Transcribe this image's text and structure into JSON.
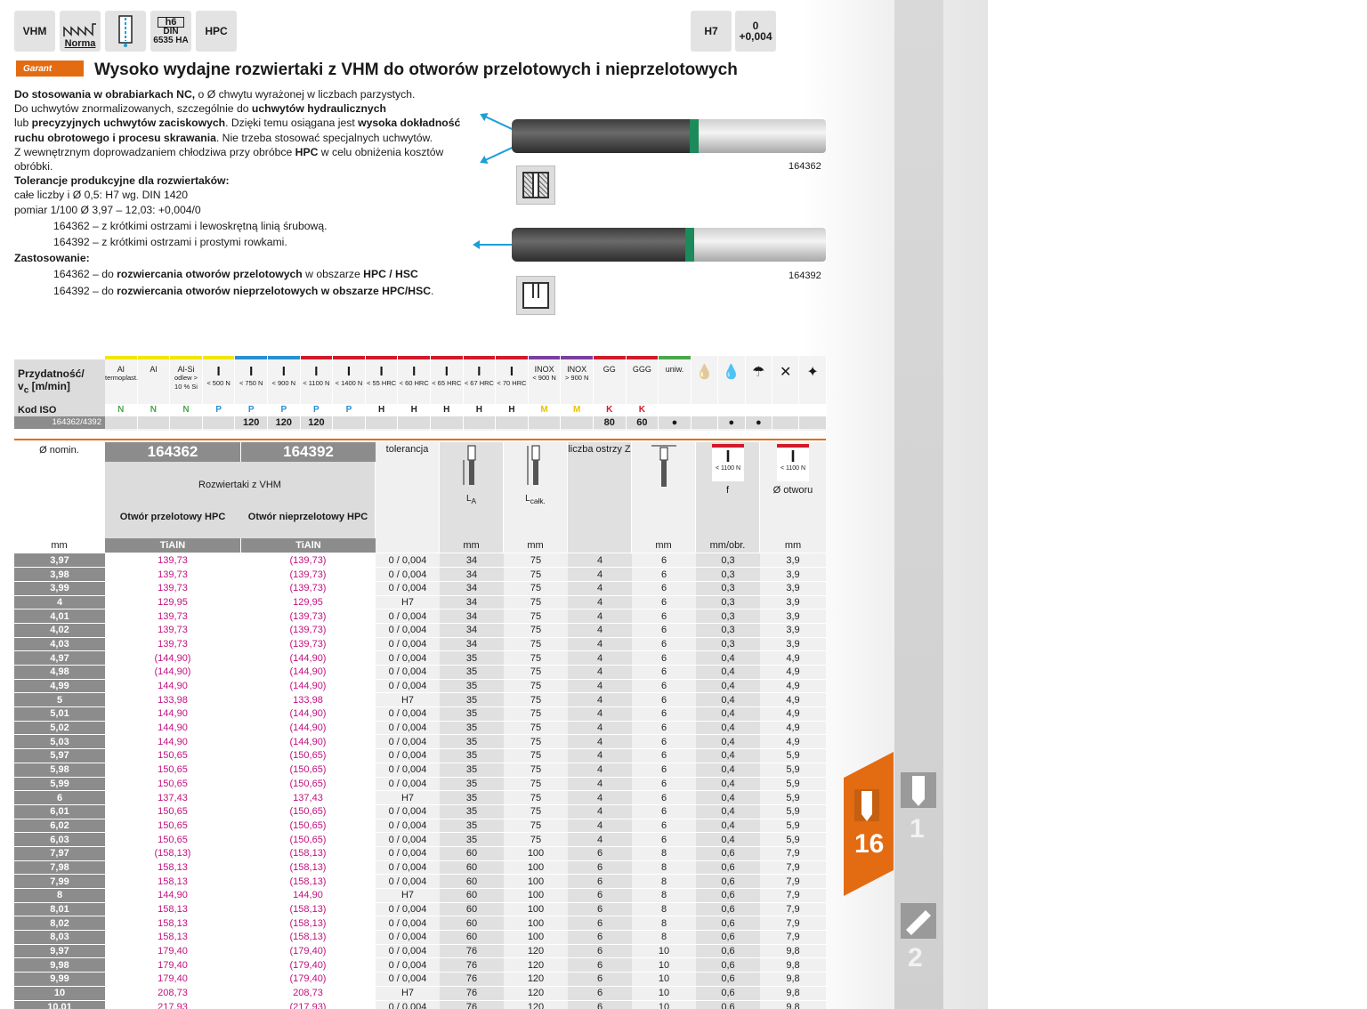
{
  "header_icons": {
    "vhm": "VHM",
    "norma": "Norma",
    "h6": "h6",
    "din": "DIN",
    "din_no": "6535 HA",
    "hpc": "HPC",
    "h7": "H7",
    "tol_top": "0",
    "tol_bottom": "+0,004"
  },
  "logo": "Garant",
  "title": "Wysoko wydajne rozwiertaki z VHM do otworów przelotowych i nieprzelotowych",
  "description": {
    "l1_b": "Do stosowania w obrabiarkach NC,",
    "l1": " o Ø chwytu wyrażonej w liczbach parzystych.",
    "l2": "Do uchwytów znormalizowanych, szczególnie do ",
    "l2_b": "uchwytów hydraulicznych",
    "l3": "lub ",
    "l3_b": "precyzyjnych uchwytów zaciskowych",
    "l3b": ". Dzięki temu osiągana jest ",
    "l3_b2": "wysoka dokładność",
    "l4_b": "ruchu obrotowego i procesu skrawania",
    "l4": ". Nie trzeba stosować specjalnych uchwytów.",
    "l5": "Z wewnętrznym doprowadzaniem chłodziwa przy obróbce ",
    "l5_b": "HPC",
    "l5b": " w celu obniżenia kosztów",
    "l6": "obróbki.",
    "tol_head": "Tolerancje produkcyjne dla rozwiertaków:",
    "tol1": "całe liczby i Ø 0,5: H7 wg. DIN 1420",
    "tol2": "pomiar 1/100 Ø 3,97 – 12,03: +0,004/0",
    "v1": "164362 –  z krótkimi ostrzami i lewoskrętną linią śrubową.",
    "v2": "164392 –  z krótkimi ostrzami i prostymi rowkami.",
    "app_head": "Zastosowanie:",
    "a1": "164362 –  do ",
    "a1_b": "rozwiercania otworów przelotowych",
    "a1b": " w obszarze ",
    "a1_b2": "HPC / HSC",
    ".": ".",
    "a2": "164392 –  do ",
    "a2_b": "rozwiercania otworów nieprzelotowych w obszarze HPC/HSC",
    "a2b": "."
  },
  "products": {
    "p1": "164362",
    "p2": "164392"
  },
  "suitability": {
    "label1": "Przydatność/",
    "label2": "v",
    "label2sub": "c",
    "label3": " [m/min]",
    "iso_label": "Kod ISO",
    "ref": "164362/4392",
    "columns": [
      {
        "t": "Al",
        "s": "termoplast.",
        "iso": "N",
        "vc": "",
        "c": "#f2e600",
        "ic": "#4aa84a"
      },
      {
        "t": "Al",
        "s": "",
        "iso": "N",
        "vc": "",
        "c": "#f2e600",
        "ic": "#4aa84a"
      },
      {
        "t": "Al-Si",
        "s": "odlew > 10 % Si",
        "iso": "N",
        "vc": "",
        "c": "#f2e600",
        "ic": "#4aa84a"
      },
      {
        "t": "I",
        "s": "< 500 N",
        "iso": "P",
        "vc": "",
        "c": "#f2e600",
        "ic": "#2a8fd1"
      },
      {
        "t": "I",
        "s": "< 750 N",
        "iso": "P",
        "vc": "120",
        "c": "#2a8fd1",
        "ic": "#2a8fd1"
      },
      {
        "t": "I",
        "s": "< 900 N",
        "iso": "P",
        "vc": "120",
        "c": "#2a8fd1",
        "ic": "#2a8fd1"
      },
      {
        "t": "I",
        "s": "< 1100 N",
        "iso": "P",
        "vc": "120",
        "c": "#d11a2a",
        "ic": "#2a8fd1"
      },
      {
        "t": "I",
        "s": "< 1400 N",
        "iso": "P",
        "vc": "",
        "c": "#d11a2a",
        "ic": "#2a8fd1"
      },
      {
        "t": "I",
        "s": "< 55 HRC",
        "iso": "H",
        "vc": "",
        "c": "#d11a2a",
        "ic": "#222"
      },
      {
        "t": "I",
        "s": "< 60 HRC",
        "iso": "H",
        "vc": "",
        "c": "#d11a2a",
        "ic": "#222"
      },
      {
        "t": "I",
        "s": "< 65 HRC",
        "iso": "H",
        "vc": "",
        "c": "#d11a2a",
        "ic": "#222"
      },
      {
        "t": "I",
        "s": "< 67 HRC",
        "iso": "H",
        "vc": "",
        "c": "#d11a2a",
        "ic": "#222"
      },
      {
        "t": "I",
        "s": "< 70 HRC",
        "iso": "H",
        "vc": "",
        "c": "#d11a2a",
        "ic": "#222"
      },
      {
        "t": "INOX",
        "s": "< 900 N",
        "iso": "M",
        "vc": "",
        "c": "#7b3fa0",
        "ic": "#e8c400"
      },
      {
        "t": "INOX",
        "s": "> 900 N",
        "iso": "M",
        "vc": "",
        "c": "#7b3fa0",
        "ic": "#e8c400"
      },
      {
        "t": "GG",
        "s": "",
        "iso": "K",
        "vc": "80",
        "c": "#d11a2a",
        "ic": "#d11a2a"
      },
      {
        "t": "GGG",
        "s": "",
        "iso": "K",
        "vc": "60",
        "c": "#d11a2a",
        "ic": "#d11a2a"
      },
      {
        "t": "uniw.",
        "s": "",
        "iso": "",
        "vc": "●",
        "c": "#4aa84a",
        "ic": "#222"
      },
      {
        "t": "",
        "s": "",
        "iso": "",
        "vc": "",
        "c": "",
        "ic": "#222"
      },
      {
        "t": "",
        "s": "",
        "iso": "",
        "vc": "●",
        "c": "",
        "ic": "#222"
      },
      {
        "t": "",
        "s": "",
        "iso": "",
        "vc": "●",
        "c": "",
        "ic": "#222"
      },
      {
        "t": "",
        "s": "",
        "iso": "",
        "vc": "",
        "c": "",
        "ic": "#222"
      },
      {
        "t": "",
        "s": "",
        "iso": "",
        "vc": "",
        "c": "",
        "ic": "#222"
      }
    ]
  },
  "table_header": {
    "nom": "Ø nomin.",
    "sub": "Rozwiertaki z VHM",
    "c1": "Otwór przelotowy HPC",
    "c2": "Otwór nieprzelotowy HPC",
    "coat": "TiAlN",
    "tol": "tolerancja",
    "la": "L",
    "la_sub": "A",
    "lc": "L",
    "lc_sub": "całk.",
    "z": "liczba ostrzy Z",
    "hrc": "< 1100 N",
    "f": "f",
    "hole": "Ø otworu",
    "u_mm": "mm",
    "u_mm2": "mm",
    "u_mm3": "mm",
    "u_mm4": "mm",
    "u_f": "mm/obr.",
    "u_mm5": "mm"
  },
  "rows": [
    [
      "3,97",
      "139,73",
      "(139,73)",
      "0 / 0,004",
      "34",
      "75",
      "4",
      "6",
      "0,3",
      "3,9"
    ],
    [
      "3,98",
      "139,73",
      "(139,73)",
      "0 / 0,004",
      "34",
      "75",
      "4",
      "6",
      "0,3",
      "3,9"
    ],
    [
      "3,99",
      "139,73",
      "(139,73)",
      "0 / 0,004",
      "34",
      "75",
      "4",
      "6",
      "0,3",
      "3,9"
    ],
    [
      "4",
      "129,95",
      "129,95",
      "H7",
      "34",
      "75",
      "4",
      "6",
      "0,3",
      "3,9"
    ],
    [
      "4,01",
      "139,73",
      "(139,73)",
      "0 / 0,004",
      "34",
      "75",
      "4",
      "6",
      "0,3",
      "3,9"
    ],
    [
      "4,02",
      "139,73",
      "(139,73)",
      "0 / 0,004",
      "34",
      "75",
      "4",
      "6",
      "0,3",
      "3,9"
    ],
    [
      "4,03",
      "139,73",
      "(139,73)",
      "0 / 0,004",
      "34",
      "75",
      "4",
      "6",
      "0,3",
      "3,9"
    ],
    [
      "4,97",
      "(144,90)",
      "(144,90)",
      "0 / 0,004",
      "35",
      "75",
      "4",
      "6",
      "0,4",
      "4,9"
    ],
    [
      "4,98",
      "(144,90)",
      "(144,90)",
      "0 / 0,004",
      "35",
      "75",
      "4",
      "6",
      "0,4",
      "4,9"
    ],
    [
      "4,99",
      "144,90",
      "(144,90)",
      "0 / 0,004",
      "35",
      "75",
      "4",
      "6",
      "0,4",
      "4,9"
    ],
    [
      "5",
      "133,98",
      "133,98",
      "H7",
      "35",
      "75",
      "4",
      "6",
      "0,4",
      "4,9"
    ],
    [
      "5,01",
      "144,90",
      "(144,90)",
      "0 / 0,004",
      "35",
      "75",
      "4",
      "6",
      "0,4",
      "4,9"
    ],
    [
      "5,02",
      "144,90",
      "(144,90)",
      "0 / 0,004",
      "35",
      "75",
      "4",
      "6",
      "0,4",
      "4,9"
    ],
    [
      "5,03",
      "144,90",
      "(144,90)",
      "0 / 0,004",
      "35",
      "75",
      "4",
      "6",
      "0,4",
      "4,9"
    ],
    [
      "5,97",
      "150,65",
      "(150,65)",
      "0 / 0,004",
      "35",
      "75",
      "4",
      "6",
      "0,4",
      "5,9"
    ],
    [
      "5,98",
      "150,65",
      "(150,65)",
      "0 / 0,004",
      "35",
      "75",
      "4",
      "6",
      "0,4",
      "5,9"
    ],
    [
      "5,99",
      "150,65",
      "(150,65)",
      "0 / 0,004",
      "35",
      "75",
      "4",
      "6",
      "0,4",
      "5,9"
    ],
    [
      "6",
      "137,43",
      "137,43",
      "H7",
      "35",
      "75",
      "4",
      "6",
      "0,4",
      "5,9"
    ],
    [
      "6,01",
      "150,65",
      "(150,65)",
      "0 / 0,004",
      "35",
      "75",
      "4",
      "6",
      "0,4",
      "5,9"
    ],
    [
      "6,02",
      "150,65",
      "(150,65)",
      "0 / 0,004",
      "35",
      "75",
      "4",
      "6",
      "0,4",
      "5,9"
    ],
    [
      "6,03",
      "150,65",
      "(150,65)",
      "0 / 0,004",
      "35",
      "75",
      "4",
      "6",
      "0,4",
      "5,9"
    ],
    [
      "7,97",
      "(158,13)",
      "(158,13)",
      "0 / 0,004",
      "60",
      "100",
      "6",
      "8",
      "0,6",
      "7,9"
    ],
    [
      "7,98",
      "158,13",
      "(158,13)",
      "0 / 0,004",
      "60",
      "100",
      "6",
      "8",
      "0,6",
      "7,9"
    ],
    [
      "7,99",
      "158,13",
      "(158,13)",
      "0 / 0,004",
      "60",
      "100",
      "6",
      "8",
      "0,6",
      "7,9"
    ],
    [
      "8",
      "144,90",
      "144,90",
      "H7",
      "60",
      "100",
      "6",
      "8",
      "0,6",
      "7,9"
    ],
    [
      "8,01",
      "158,13",
      "(158,13)",
      "0 / 0,004",
      "60",
      "100",
      "6",
      "8",
      "0,6",
      "7,9"
    ],
    [
      "8,02",
      "158,13",
      "(158,13)",
      "0 / 0,004",
      "60",
      "100",
      "6",
      "8",
      "0,6",
      "7,9"
    ],
    [
      "8,03",
      "158,13",
      "(158,13)",
      "0 / 0,004",
      "60",
      "100",
      "6",
      "8",
      "0,6",
      "7,9"
    ],
    [
      "9,97",
      "179,40",
      "(179,40)",
      "0 / 0,004",
      "76",
      "120",
      "6",
      "10",
      "0,6",
      "9,8"
    ],
    [
      "9,98",
      "179,40",
      "(179,40)",
      "0 / 0,004",
      "76",
      "120",
      "6",
      "10",
      "0,6",
      "9,8"
    ],
    [
      "9,99",
      "179,40",
      "(179,40)",
      "0 / 0,004",
      "76",
      "120",
      "6",
      "10",
      "0,6",
      "9,8"
    ],
    [
      "10",
      "208,73",
      "208,73",
      "H7",
      "76",
      "120",
      "6",
      "10",
      "0,6",
      "9,8"
    ],
    [
      "10,01",
      "217,93",
      "(217,93)",
      "0 / 0,004",
      "76",
      "120",
      "6",
      "10",
      "0,6",
      "9,8"
    ]
  ],
  "side_tabs": {
    "active": "16",
    "t1": "1",
    "t2": "2"
  },
  "colors": {
    "accent": "#e36b12",
    "price": "#c2117e",
    "grey": "#8c8c8c"
  }
}
